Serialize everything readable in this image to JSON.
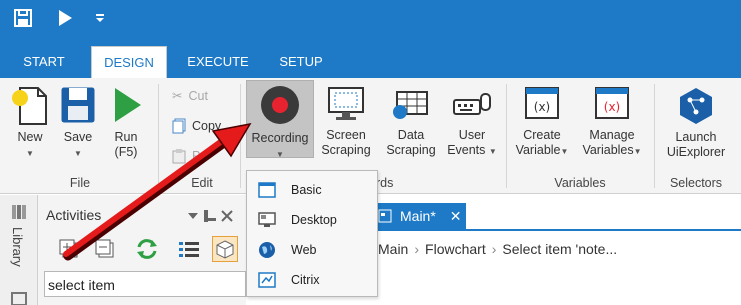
{
  "colors": {
    "accent": "#1e7ac6",
    "record_red": "#e8232f",
    "run_green": "#2ea043",
    "arrow_red": "#e51b1b"
  },
  "tabs": [
    {
      "label": "START"
    },
    {
      "label": "DESIGN",
      "active": true
    },
    {
      "label": "EXECUTE"
    },
    {
      "label": "SETUP"
    }
  ],
  "ribbon": {
    "file": {
      "new_label": "New",
      "save_label": "Save",
      "run_label": "Run",
      "run_shortcut": "(F5)",
      "group_label": "File"
    },
    "edit": {
      "cut_label": "Cut",
      "copy_label": "Copy",
      "paste_label": "Pa",
      "group_label": "Edit"
    },
    "wizards": {
      "recording_label": "Recording",
      "screen_scraping_l1": "Screen",
      "screen_scraping_l2": "Scraping",
      "data_scraping_l1": "Data",
      "data_scraping_l2": "Scraping",
      "user_events_l1": "User",
      "user_events_l2": "Events",
      "group_label_partial": "rds"
    },
    "variables": {
      "create_l1": "Create",
      "create_l2": "Variable",
      "manage_l1": "Manage",
      "manage_l2": "Variables",
      "group_label": "Variables"
    },
    "selectors": {
      "launch_l1": "Launch",
      "launch_l2": "UiExplorer",
      "group_label": "Selectors"
    }
  },
  "recording_menu": [
    {
      "label": "Basic",
      "icon": "basic-window-icon"
    },
    {
      "label": "Desktop",
      "icon": "desktop-icon"
    },
    {
      "label": "Web",
      "icon": "globe-icon"
    },
    {
      "label": "Citrix",
      "icon": "citrix-icon"
    }
  ],
  "left_strip": {
    "library_label": "Library"
  },
  "activities": {
    "title": "Activities",
    "search_value": "select item"
  },
  "document": {
    "tab_label": "Main*",
    "breadcrumb": [
      "Main",
      "Flowchart",
      "Select item 'note..."
    ]
  }
}
